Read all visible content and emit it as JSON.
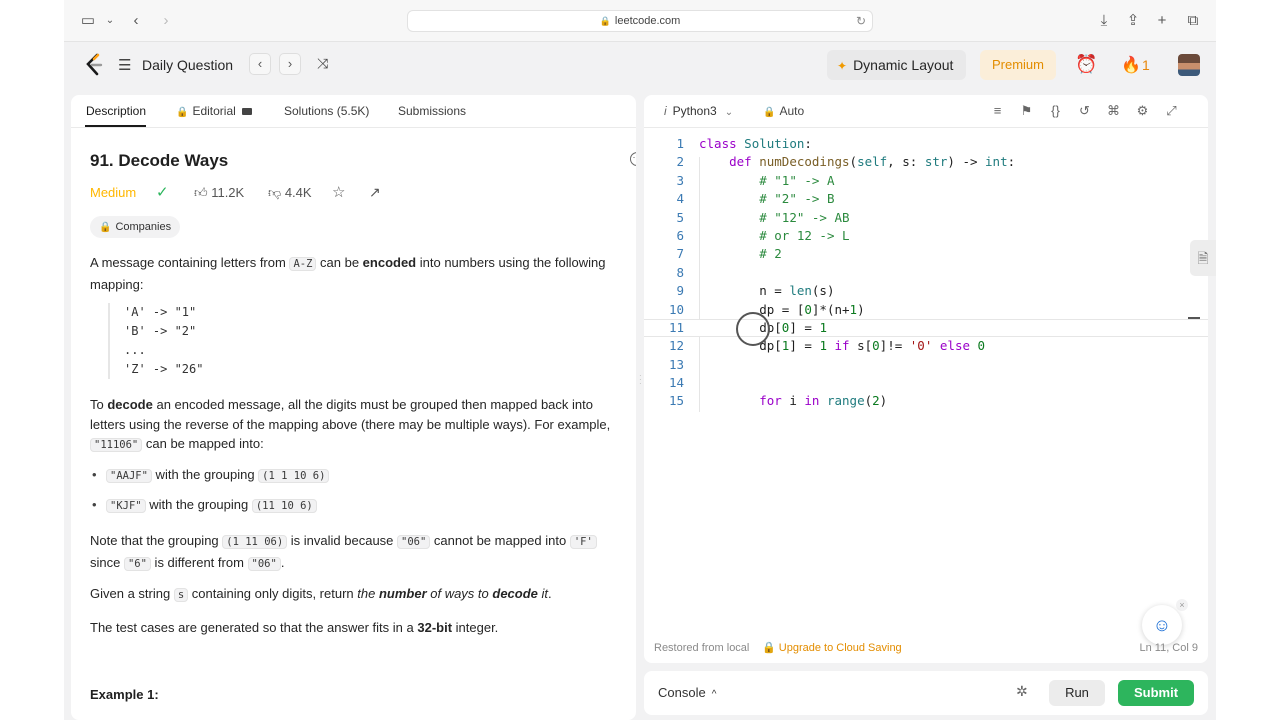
{
  "browser": {
    "url": "leetcode.com"
  },
  "header": {
    "daily_question": "Daily Question",
    "dynamic_layout": "Dynamic Layout",
    "premium": "Premium",
    "streak_count": "1",
    "colors": {
      "premium_text": "#e38d00",
      "flame": "#f17b16"
    }
  },
  "description": {
    "tabs": [
      "Description",
      "Editorial",
      "Solutions (5.5K)",
      "Submissions"
    ],
    "title": "91. Decode Ways",
    "difficulty": "Medium",
    "likes": "11.2K",
    "dislikes": "4.4K",
    "companies": "Companies",
    "p1_a": "A message containing letters from ",
    "p1_code": "A-Z",
    "p1_b": " can be ",
    "p1_bold": "encoded",
    "p1_c": " into numbers using the following mapping:",
    "mapping": [
      "'A' -> \"1\"",
      "'B' -> \"2\"",
      "...",
      "'Z' -> \"26\""
    ],
    "p2_a": "To ",
    "p2_bold": "decode",
    "p2_b": " an encoded message, all the digits must be grouped then mapped back into letters using the reverse of the mapping above (there may be multiple ways). For example, ",
    "p2_code": "\"11106\"",
    "p2_c": " can be mapped into:",
    "b1_code": "\"AAJF\"",
    "b1_text": " with the grouping ",
    "b1_group": "(1 1 10 6)",
    "b2_code": "\"KJF\"",
    "b2_text": " with the grouping ",
    "b2_group": "(11 10 6)",
    "p3_a": "Note that the grouping ",
    "p3_code1": "(1 11 06)",
    "p3_b": " is invalid because ",
    "p3_code2": "\"06\"",
    "p3_c": " cannot be mapped into ",
    "p3_code3": "'F'",
    "p3_d": " since ",
    "p3_code4": "\"6\"",
    "p3_e": " is different from ",
    "p3_code5": "\"06\"",
    "p3_f": ".",
    "p4_a": "Given a string ",
    "p4_code": "s",
    "p4_b": " containing only digits, return ",
    "p4_i1": "the ",
    "p4_bi": "number",
    "p4_i2": " of ways to ",
    "p4_bi2": "decode",
    "p4_i3": " it",
    "p4_c": ".",
    "p5_a": "The test cases are generated so that the answer fits in a ",
    "p5_bold": "32-bit",
    "p5_b": " integer.",
    "example": "Example 1:",
    "colors": {
      "difficulty": "#ffb700",
      "editorial_lock": "#e59c00"
    }
  },
  "editor": {
    "language": "Python3",
    "mode": "Auto",
    "lines": [
      "class Solution:",
      "    def numDecodings(self, s: str) -> int:",
      "        # \"1\" -> A",
      "        # \"2\" -> B",
      "        # \"12\" -> AB",
      "        # or 12 -> L",
      "        # 2",
      "",
      "        n = len(s)",
      "        dp = [0]*(n+1)",
      "        dp[0] = 1",
      "        dp[1] = 1 if s[0]!= '0' else 0",
      "",
      "",
      "        for i in range(2)"
    ],
    "footer_status": "Restored from local",
    "footer_upgrade": "Upgrade to Cloud Saving",
    "cursor_pos": "Ln 11, Col 9"
  },
  "console": {
    "label": "Console",
    "run": "Run",
    "submit": "Submit",
    "colors": {
      "submit_bg": "#2db55d"
    }
  }
}
